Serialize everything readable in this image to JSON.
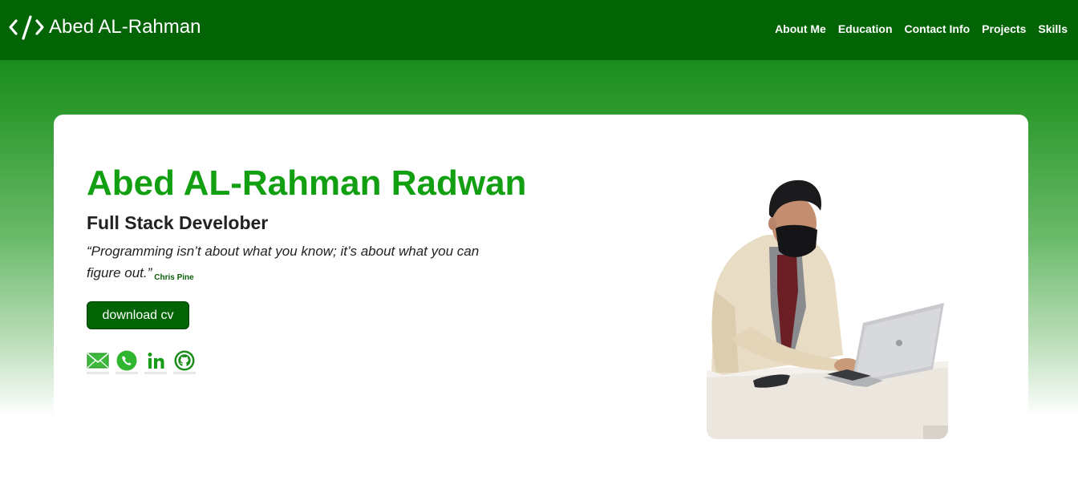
{
  "navbar": {
    "brand_icon": "code-icon",
    "brand_name": "Abed AL-Rahman",
    "links": [
      {
        "label": "About Me"
      },
      {
        "label": "Education"
      },
      {
        "label": "Contact Info"
      },
      {
        "label": "Projects"
      },
      {
        "label": "Skills"
      }
    ]
  },
  "hero": {
    "name": "Abed AL-Rahman Radwan",
    "role": "Full Stack Develober",
    "quote": "“Programming isn’t about what you know; it’s about what you can figure out.”",
    "quote_author": "Chris Pine",
    "cv_button": "download cv",
    "social_icons": [
      "email-icon",
      "whatsapp-icon",
      "linkedin-icon",
      "github-icon"
    ]
  },
  "colors": {
    "nav_background": "#036406",
    "name_green": "#12a012",
    "button_green": "#036406",
    "gradient_top": "#0a7a12"
  }
}
